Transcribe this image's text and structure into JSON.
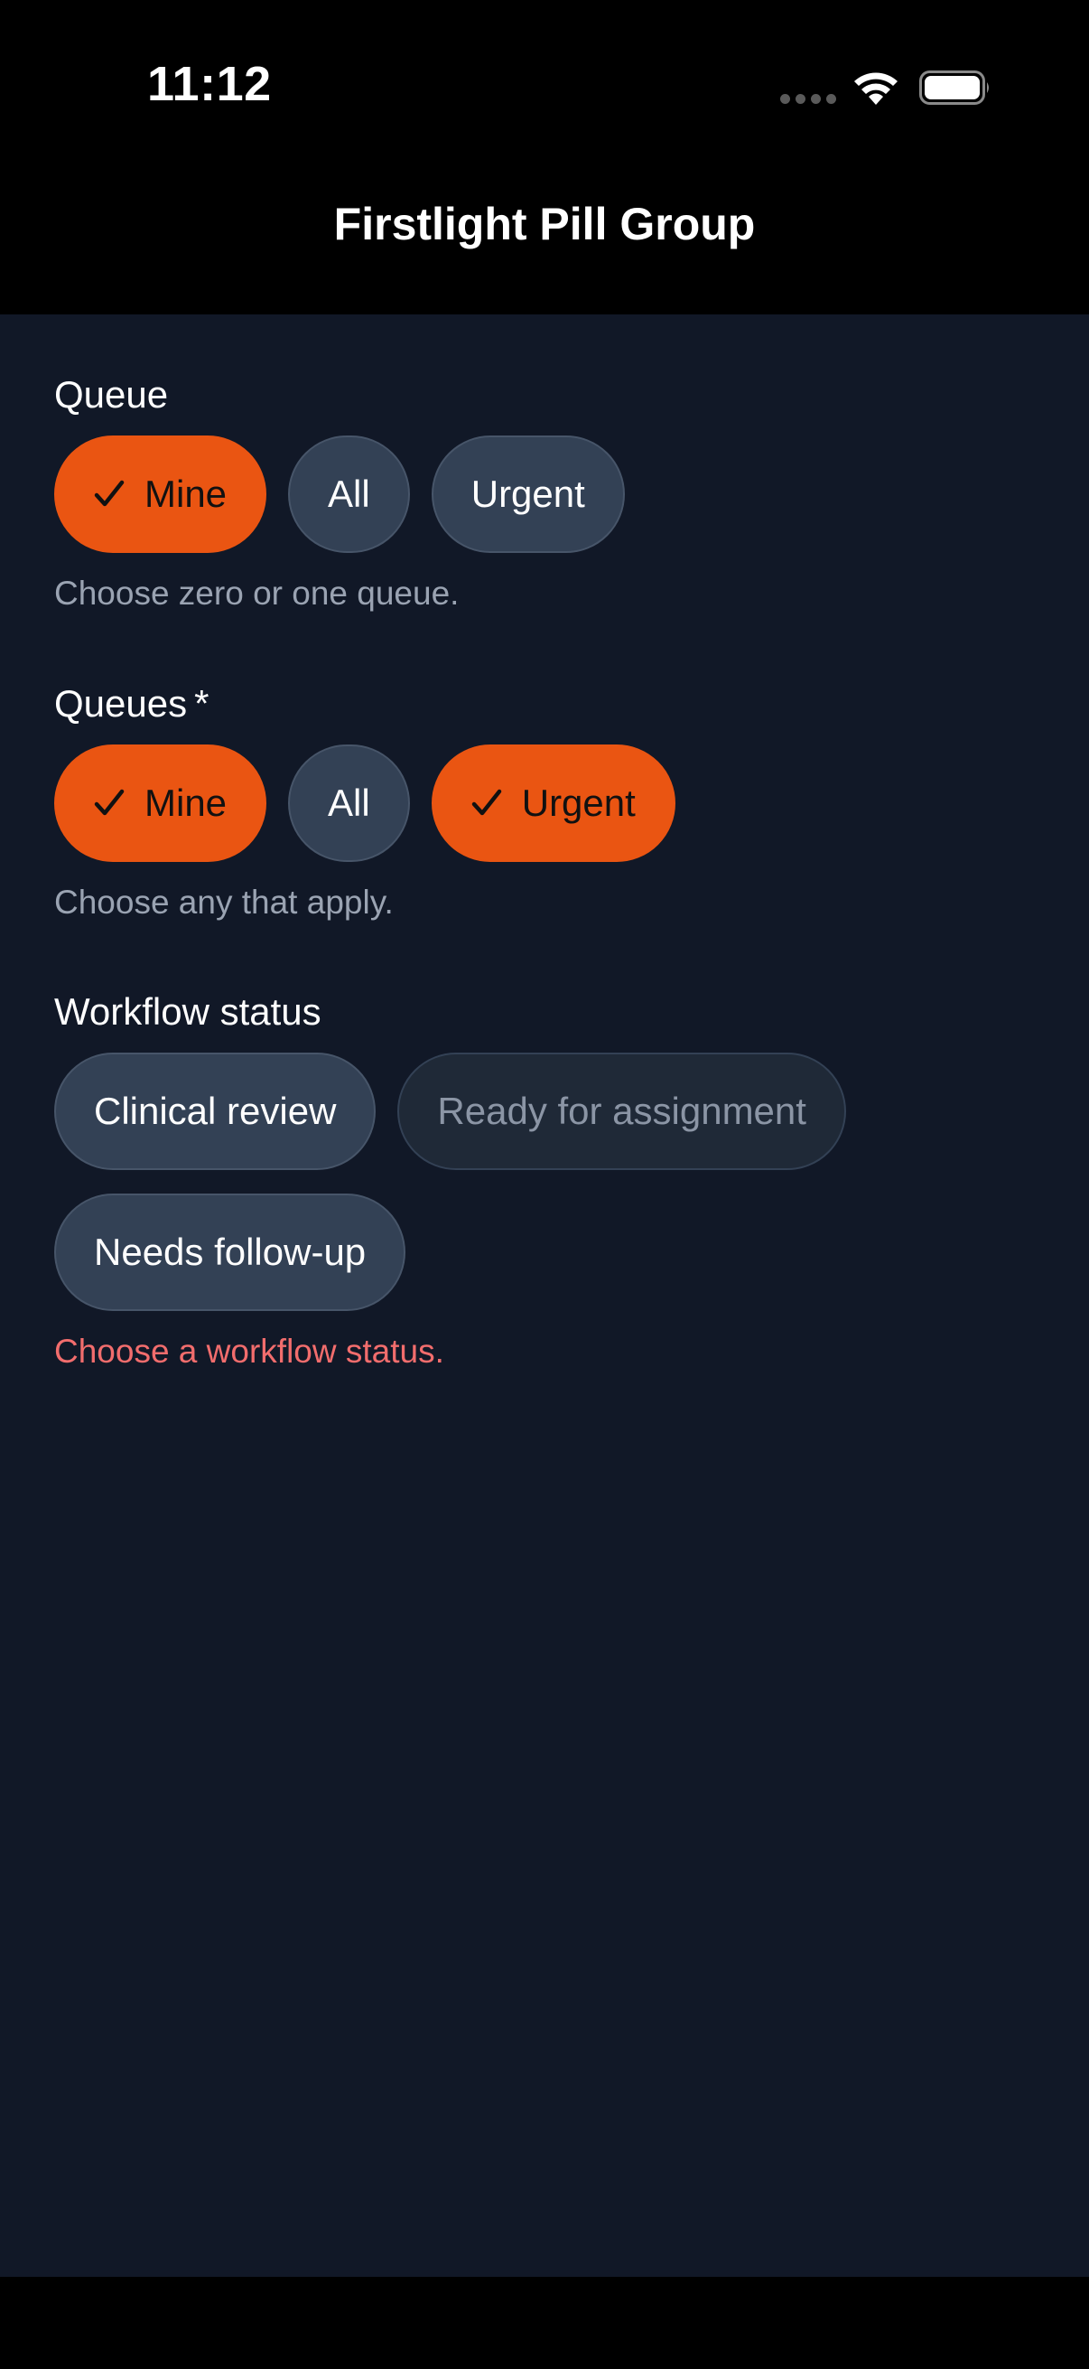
{
  "status_bar": {
    "time": "11:12"
  },
  "nav": {
    "title": "Firstlight Pill Group"
  },
  "groups": [
    {
      "label": "Queue",
      "required": "",
      "helper": "Choose zero or one queue.",
      "options": [
        {
          "label": "Mine",
          "state": "selected"
        },
        {
          "label": "All",
          "state": "unselected"
        },
        {
          "label": "Urgent",
          "state": "unselected"
        }
      ]
    },
    {
      "label": "Queues",
      "required": "*",
      "helper": "Choose any that apply.",
      "options": [
        {
          "label": "Mine",
          "state": "selected"
        },
        {
          "label": "All",
          "state": "unselected"
        },
        {
          "label": "Urgent",
          "state": "selected"
        }
      ]
    },
    {
      "label": "Workflow status",
      "required": "",
      "helper": "Choose a workflow status.",
      "helper_state": "error",
      "options": [
        {
          "label": "Clinical review",
          "state": "unselected"
        },
        {
          "label": "Ready for assignment",
          "state": "disabled"
        },
        {
          "label": "Needs follow-up",
          "state": "unselected"
        }
      ]
    }
  ],
  "icons": {
    "selected_chip": "checkmark-icon",
    "status": [
      "cellular-signal-icon",
      "wifi-icon",
      "battery-icon"
    ]
  },
  "colors": {
    "background": "#111827",
    "accent": "#ea5512",
    "chip": "#334155",
    "error": "#f26d6d",
    "helper": "#9aa3b2"
  }
}
